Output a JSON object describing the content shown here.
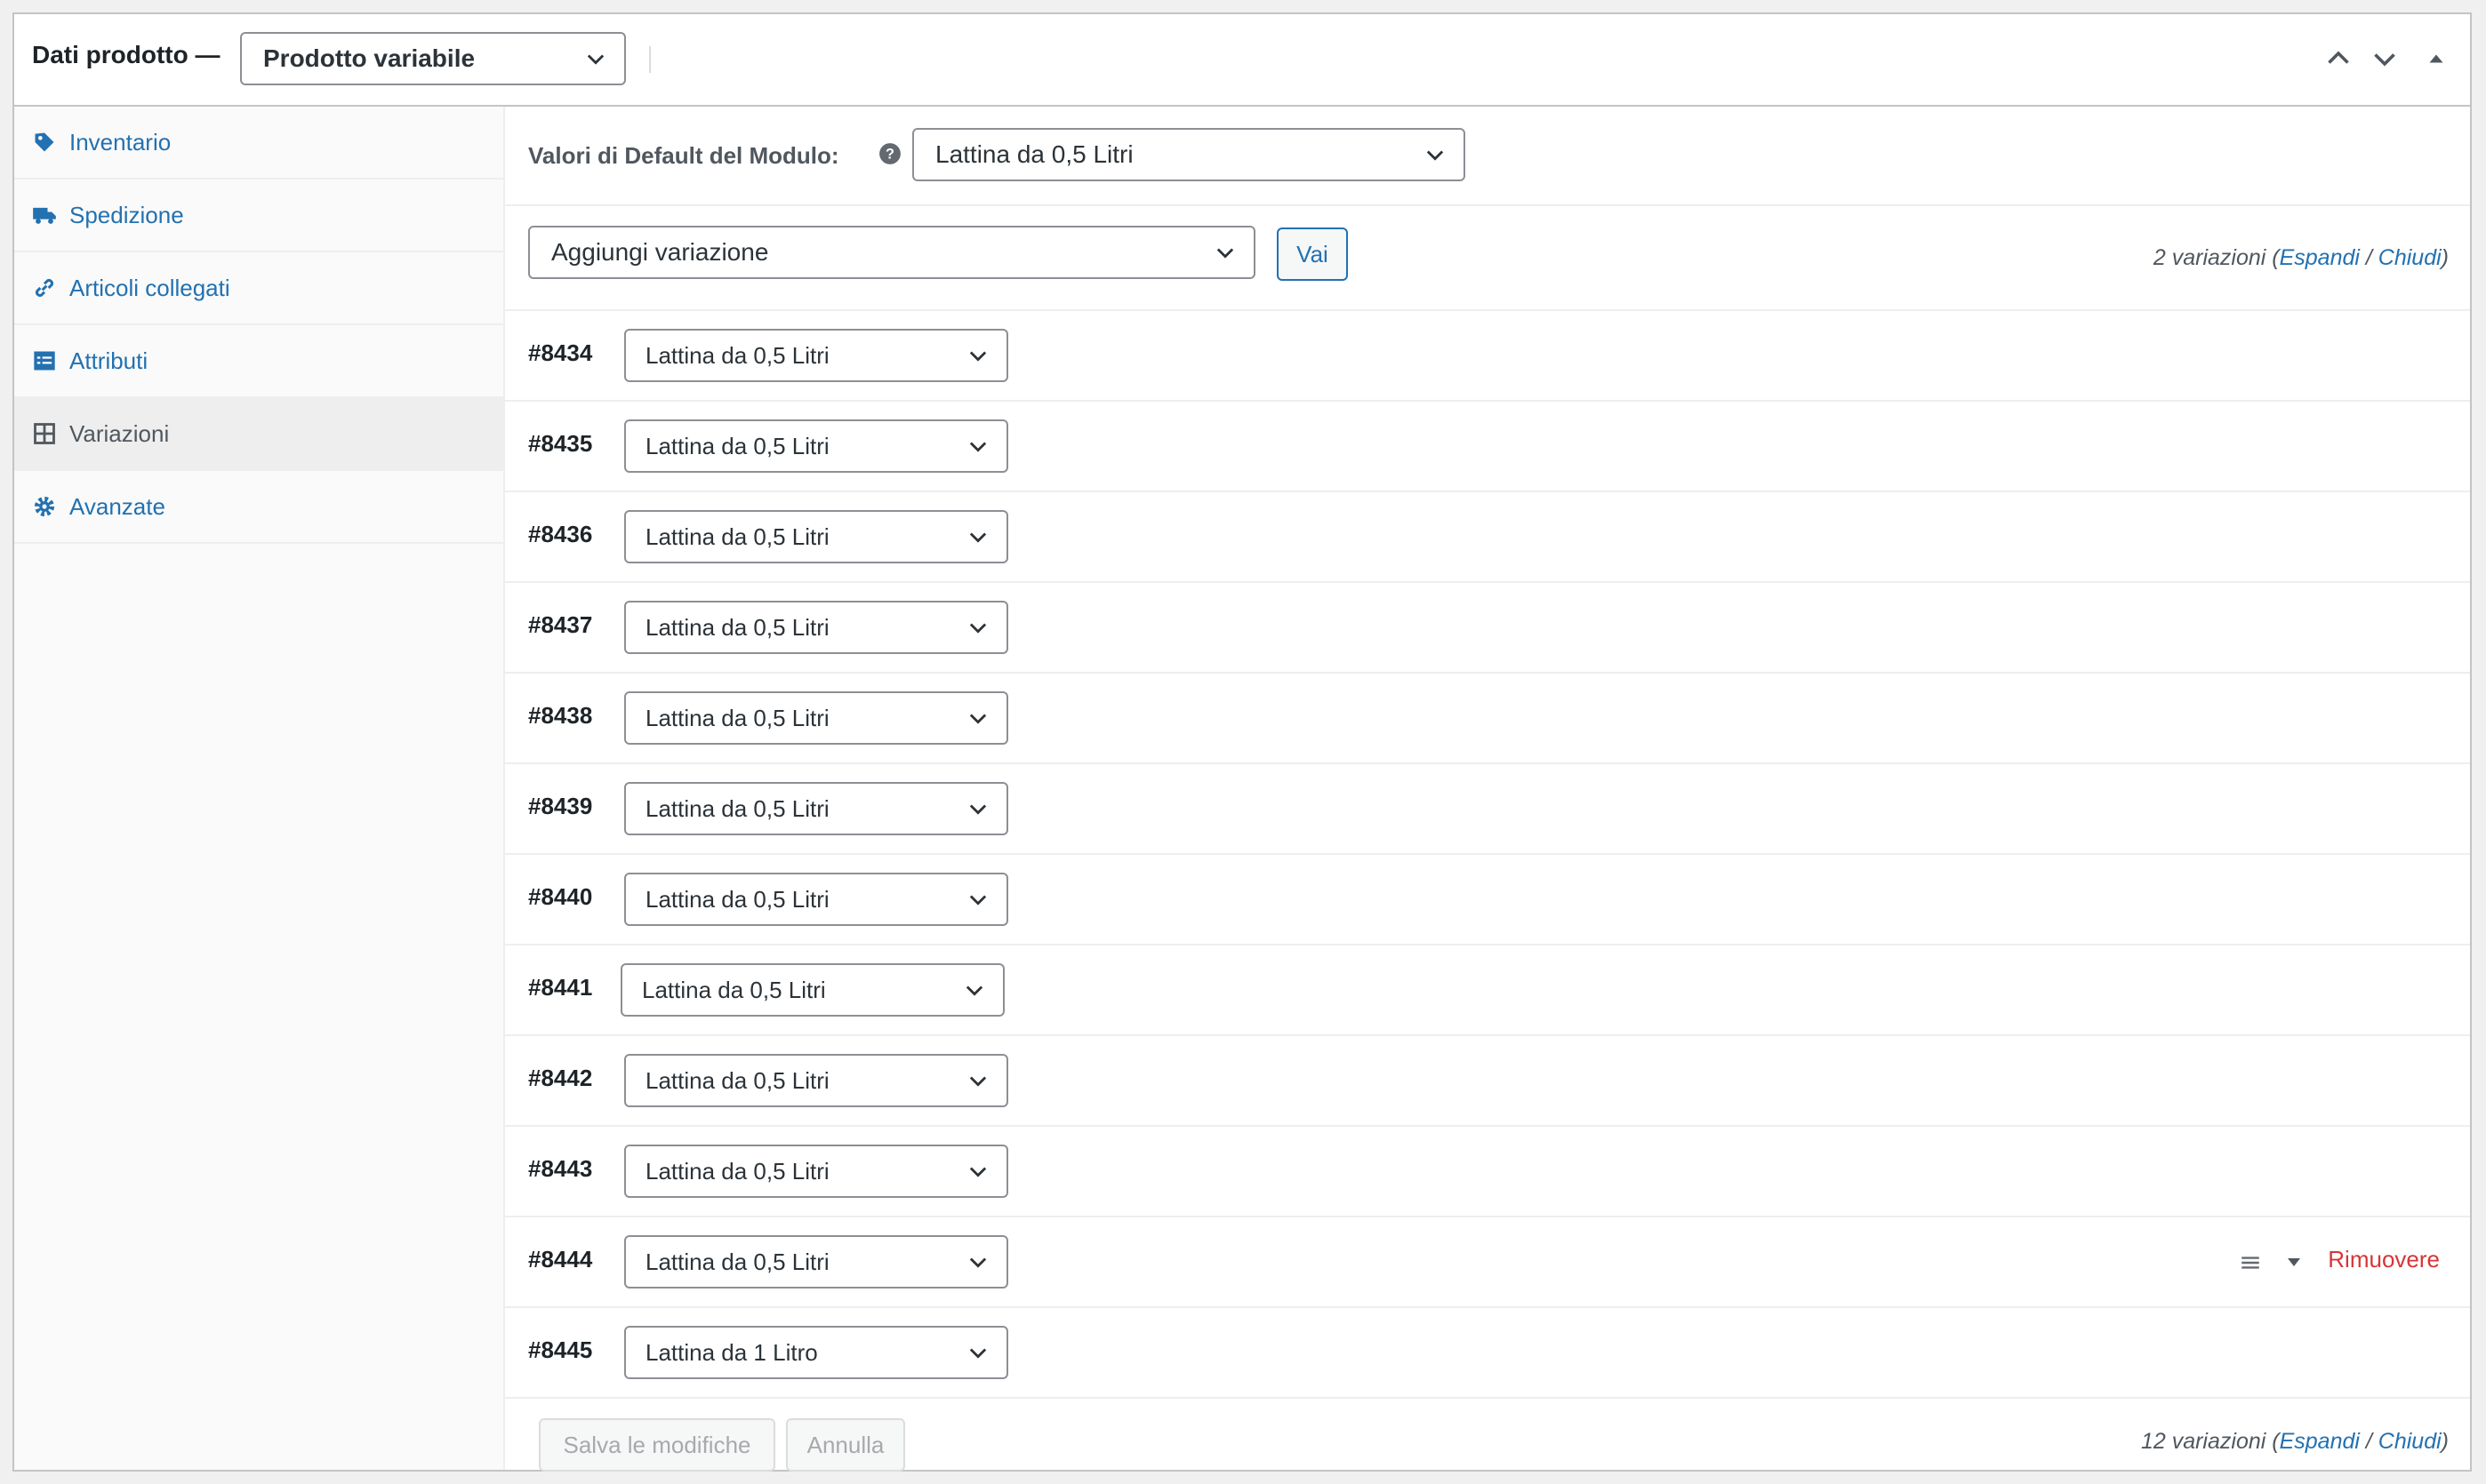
{
  "header": {
    "title": "Dati prodotto —",
    "product_type": "Prodotto variabile",
    "icons": [
      "chevron-up-icon",
      "chevron-down-icon",
      "triangle-up-icon"
    ]
  },
  "sidebar": {
    "items": [
      {
        "label": "Inventario",
        "icon": "tag-icon"
      },
      {
        "label": "Spedizione",
        "icon": "truck-icon"
      },
      {
        "label": "Articoli collegati",
        "icon": "link-icon"
      },
      {
        "label": "Attributi",
        "icon": "list-icon"
      },
      {
        "label": "Variazioni",
        "icon": "grid-icon",
        "active": true
      },
      {
        "label": "Avanzate",
        "icon": "gear-icon"
      }
    ]
  },
  "defaults": {
    "label": "Valori di Default del Modulo:",
    "value": "Lattina da 0,5 Litri"
  },
  "actions": {
    "add_variation": "Aggiungi variazione",
    "go": "Vai",
    "top_count_text": "2 variazioni",
    "bottom_count_text": "12 variazioni",
    "open_paren": "(",
    "expand": "Espandi",
    "sep": " / ",
    "collapse": "Chiudi",
    "close_paren": ")"
  },
  "variations": [
    {
      "id": "#8434",
      "value": "Lattina da 0,5 Litri"
    },
    {
      "id": "#8435",
      "value": "Lattina da 0,5 Litri"
    },
    {
      "id": "#8436",
      "value": "Lattina da 0,5 Litri"
    },
    {
      "id": "#8437",
      "value": "Lattina da 0,5 Litri"
    },
    {
      "id": "#8438",
      "value": "Lattina da 0,5 Litri"
    },
    {
      "id": "#8439",
      "value": "Lattina da 0,5 Litri"
    },
    {
      "id": "#8440",
      "value": "Lattina da 0,5 Litri"
    },
    {
      "id": "#8441",
      "value": "Lattina da 0,5 Litri"
    },
    {
      "id": "#8442",
      "value": "Lattina da 0,5 Litri"
    },
    {
      "id": "#8443",
      "value": "Lattina da 0,5 Litri"
    },
    {
      "id": "#8444",
      "value": "Lattina da 0,5 Litri"
    },
    {
      "id": "#8445",
      "value": "Lattina da 1 Litro"
    }
  ],
  "hovered_row": {
    "remove_label": "Rimuovere"
  },
  "footer": {
    "save": "Salva le modifiche",
    "cancel": "Annulla"
  },
  "colors": {
    "link": "#2271b1",
    "danger": "#d63638",
    "border": "#c3c4c7"
  }
}
